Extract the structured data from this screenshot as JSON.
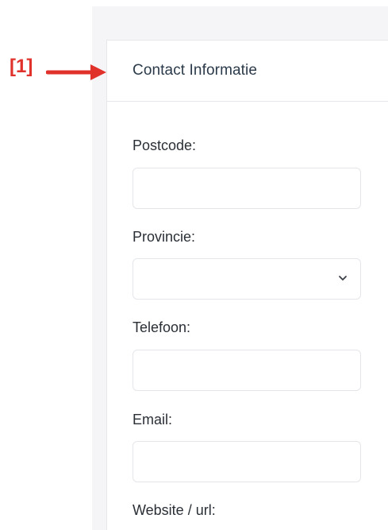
{
  "annotation": {
    "marker": "[1]",
    "color": "#e0312b"
  },
  "card": {
    "title": "Contact Informatie"
  },
  "fields": {
    "postcode": {
      "label": "Postcode:",
      "value": ""
    },
    "provincie": {
      "label": "Provincie:",
      "value": "",
      "icon": "chevron-down-icon"
    },
    "telefoon": {
      "label": "Telefoon:",
      "value": ""
    },
    "email": {
      "label": "Email:",
      "value": ""
    },
    "website": {
      "label": "Website / url:"
    }
  },
  "colors": {
    "title": "#2b3a4a",
    "label": "#2a2f36",
    "border": "#e4e6ea",
    "background": "#f5f5f7"
  }
}
